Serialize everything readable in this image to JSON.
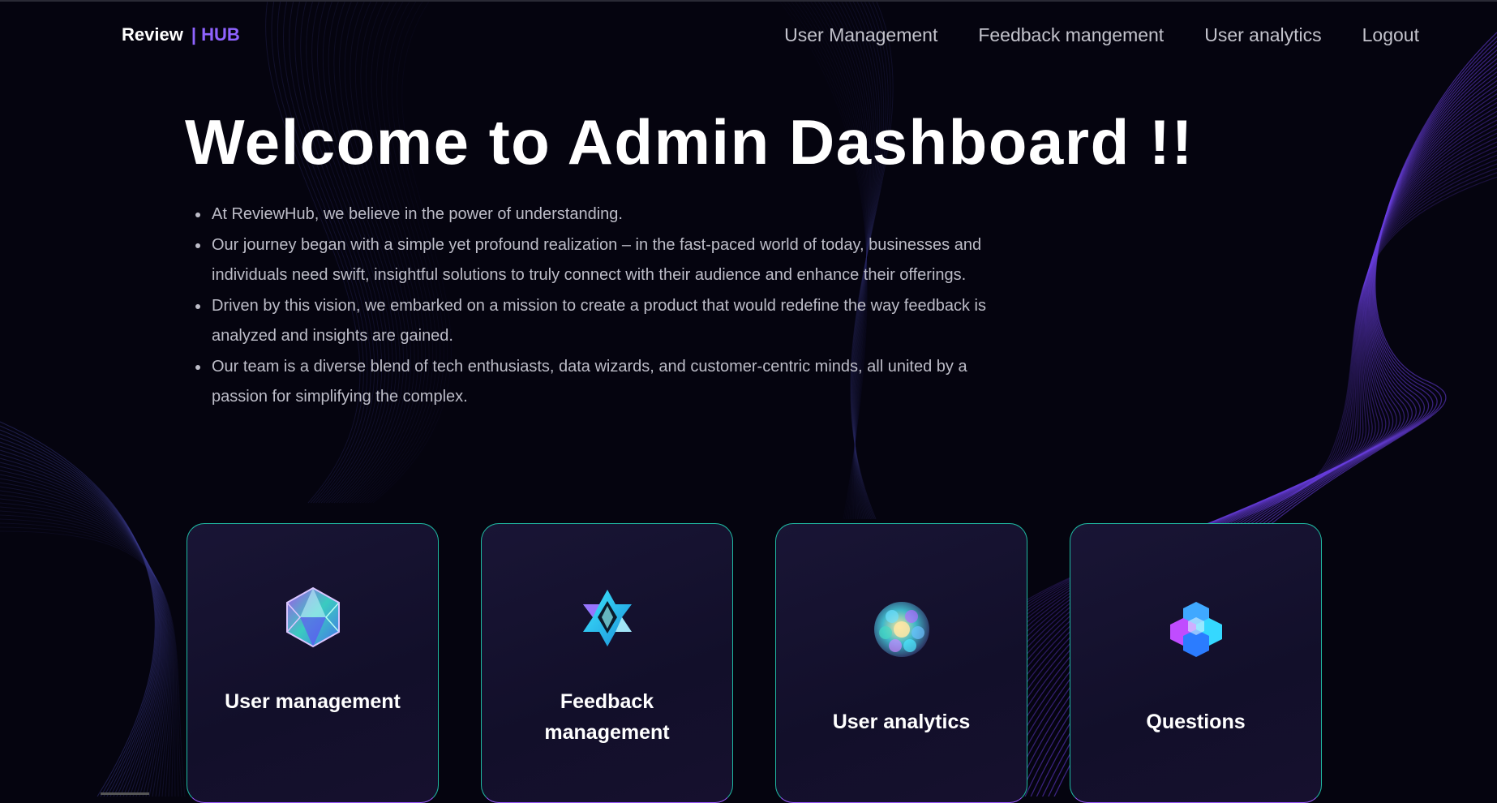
{
  "brand": {
    "part1": "Review",
    "part2": "| HUB"
  },
  "nav": {
    "items": [
      {
        "label": "User Management"
      },
      {
        "label": "Feedback mangement"
      },
      {
        "label": "User analytics"
      },
      {
        "label": "Logout"
      }
    ]
  },
  "hero": {
    "title": "Welcome to Admin Dashboard !!",
    "points": [
      "At ReviewHub, we believe in the power of understanding.",
      "Our journey began with a simple yet profound realization – in the fast-paced world of today, businesses and individuals need swift, insightful solutions to truly connect with their audience and enhance their offerings.",
      "Driven by this vision, we embarked on a mission to create a product that would redefine the way feedback is analyzed and insights are gained.",
      "Our team is a diverse blend of tech enthusiasts, data wizards, and customer-centric minds, all united by a passion for simplifying the complex."
    ]
  },
  "cards": [
    {
      "label": "User management",
      "icon": "icosahedron-icon"
    },
    {
      "label": "Feedback management",
      "icon": "geometric-star-icon"
    },
    {
      "label": "User analytics",
      "icon": "sphere-cluster-icon"
    },
    {
      "label": "Questions",
      "icon": "hexagon-cluster-icon"
    }
  ],
  "colors": {
    "background": "#05040f",
    "accent": "#8f63ff",
    "card_border": "#1fb9a2",
    "text_muted": "#bdbdc8"
  }
}
